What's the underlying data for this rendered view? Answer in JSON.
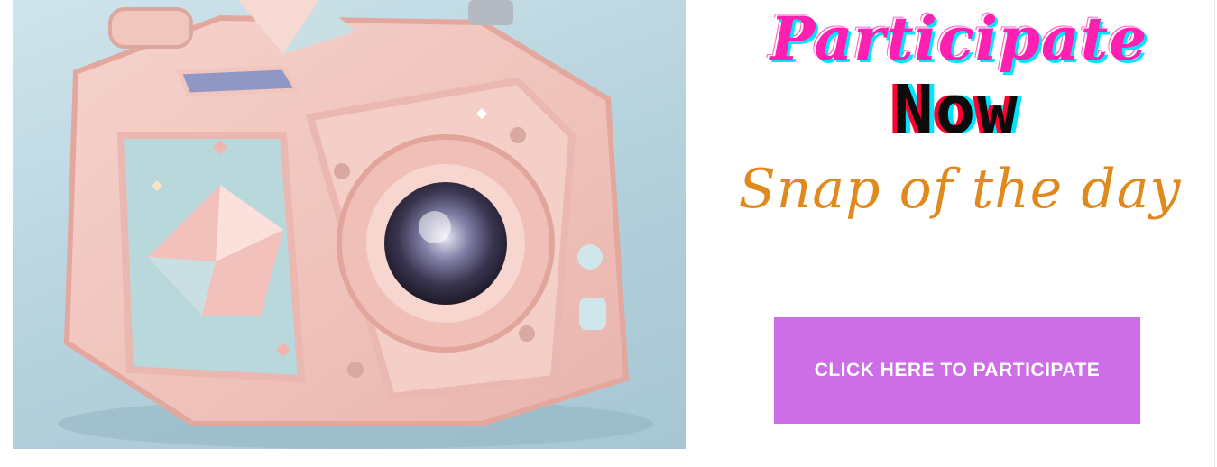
{
  "hero": {
    "image_subject": "pastel-camera-illustration",
    "heading_line1": "Participate",
    "heading_line2": "Now",
    "subheading": "Snap of the day"
  },
  "cta": {
    "label": "CLICK HERE TO PARTICIPATE"
  },
  "colors": {
    "accent_pink": "#ff1fb0",
    "accent_cyan": "#00e5ff",
    "accent_orange": "#e08a1e",
    "button_purple": "#cd6ee6"
  }
}
